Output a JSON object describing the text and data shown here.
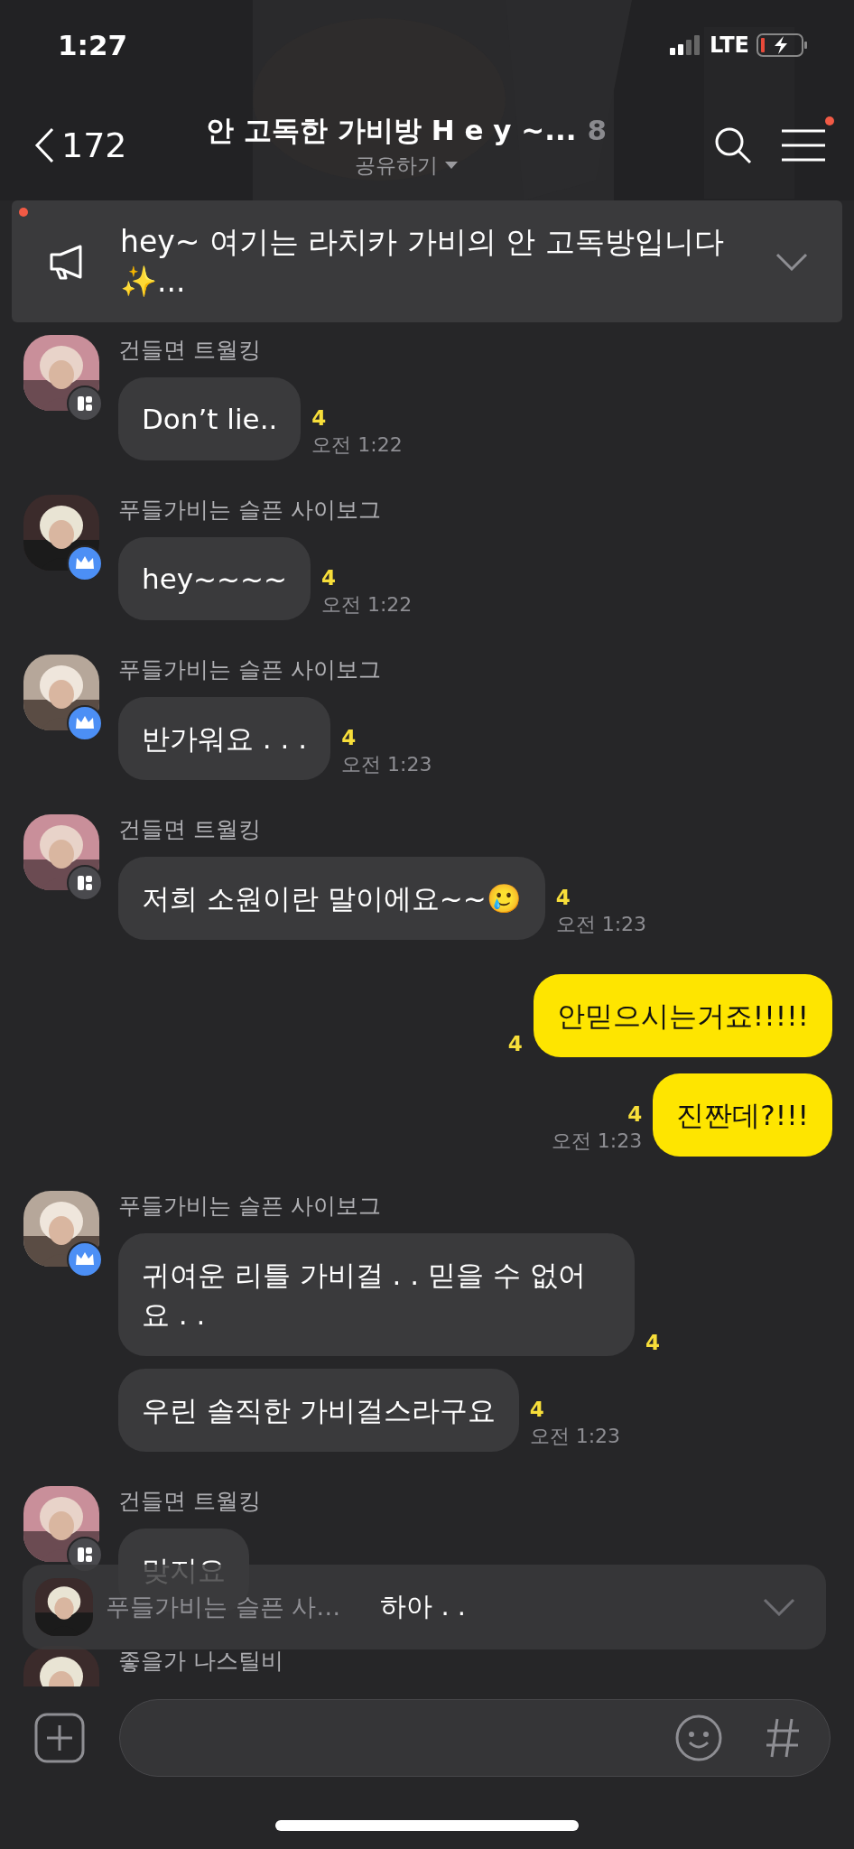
{
  "status_bar": {
    "time": "1:27",
    "network": "LTE"
  },
  "header": {
    "back_count": "172",
    "title": "안 고독한 가비방 H e y ~...",
    "member_count": "8",
    "subtitle": "공유하기",
    "menu_badge": true
  },
  "notice": {
    "text": "hey~ 여기는 라치카 가비의 안 고독방입니다 ✨...",
    "unread": true
  },
  "messages": [
    {
      "kind": "received",
      "sender": "건들면 트월킹",
      "host": false,
      "bubbles": [
        {
          "text": "Don’t lie..",
          "read_count": "4",
          "time": "오전 1:22"
        }
      ]
    },
    {
      "kind": "received",
      "sender": "푸들가비는 슬픈 사이보그",
      "host": true,
      "bubbles": [
        {
          "text": "hey~~~~",
          "read_count": "4",
          "time": "오전 1:22"
        }
      ]
    },
    {
      "kind": "received",
      "sender": "푸들가비는 슬픈 사이보그",
      "host": true,
      "bubbles": [
        {
          "text": "반가워요 . . .",
          "read_count": "4",
          "time": "오전 1:23"
        }
      ]
    },
    {
      "kind": "received",
      "sender": "건들면 트월킹",
      "host": false,
      "bubbles": [
        {
          "text": "저희 소원이란 말이에요~~🥲",
          "read_count": "4",
          "time": "오전 1:23"
        }
      ]
    },
    {
      "kind": "sent",
      "bubbles": [
        {
          "text": "안믿으시는거죠!!!!!",
          "read_count": "4"
        },
        {
          "text": "진짠데?!!!",
          "read_count": "4",
          "time": "오전 1:23"
        }
      ]
    },
    {
      "kind": "received",
      "sender": "푸들가비는 슬픈 사이보그",
      "host": true,
      "bubbles": [
        {
          "text": "귀여운 리틀 가비걸 . . 믿을 수 없어요 . .",
          "read_count": "4"
        },
        {
          "text": "우린 솔직한 가비걸스라구요",
          "read_count": "4",
          "time": "오전 1:23"
        }
      ]
    },
    {
      "kind": "received",
      "sender": "건들면 트월킹",
      "host": false,
      "bubbles": [
        {
          "text": "맞지요"
        }
      ]
    },
    {
      "kind": "received",
      "sender": "좋을가 나스틸비"
    }
  ],
  "new_message_banner": {
    "sender": "푸들가비는 슬픈 사…",
    "text": "하아 . ."
  }
}
